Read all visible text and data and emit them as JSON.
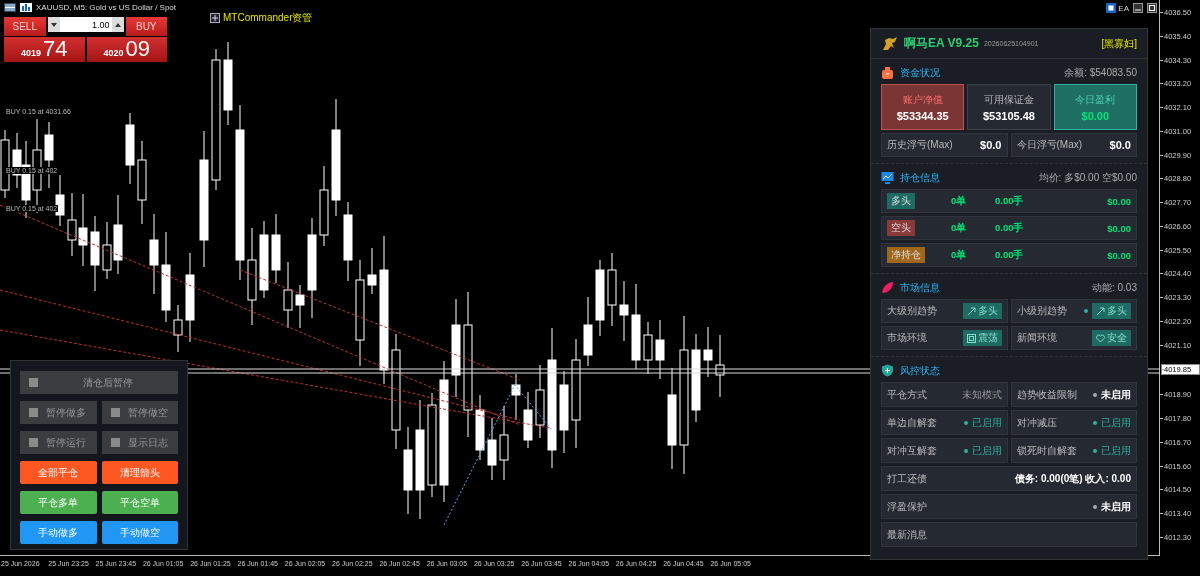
{
  "chart_header": {
    "symbol_title": "XAUUSD, M5:  Gold vs US Dollar / Spot"
  },
  "one_click": {
    "sell_label": "SELL",
    "buy_label": "BUY",
    "volume": "1.00",
    "sell_price_main": "4019",
    "sell_price_pips": "74",
    "buy_price_main": "4020",
    "buy_price_pips": "09"
  },
  "commander_label": "MTCommander资管",
  "top_right_label": "EA",
  "order_lines": [
    {
      "text": "BUY 0.15 at 4031.66"
    },
    {
      "text": "BUY 0.15 at 402"
    },
    {
      "text": "BUY 0.15 at 402"
    }
  ],
  "price_axis": {
    "ticks": [
      {
        "text": "4036.50",
        "current": false
      },
      {
        "text": "4035.40",
        "current": false
      },
      {
        "text": "4034.30",
        "current": false
      },
      {
        "text": "4033.20",
        "current": false
      },
      {
        "text": "4032.10",
        "current": false
      },
      {
        "text": "4031.00",
        "current": false
      },
      {
        "text": "4029.90",
        "current": false
      },
      {
        "text": "4028.80",
        "current": false
      },
      {
        "text": "4027.70",
        "current": false
      },
      {
        "text": "4026.60",
        "current": false
      },
      {
        "text": "4025.50",
        "current": false
      },
      {
        "text": "4024.40",
        "current": false
      },
      {
        "text": "4023.30",
        "current": false
      },
      {
        "text": "4022.20",
        "current": false
      },
      {
        "text": "4021.10",
        "current": false
      },
      {
        "text": "4019.85",
        "current": true
      },
      {
        "text": "4018.90",
        "current": false
      },
      {
        "text": "4017.80",
        "current": false
      },
      {
        "text": "4016.70",
        "current": false
      },
      {
        "text": "4015.60",
        "current": false
      },
      {
        "text": "4014.50",
        "current": false
      },
      {
        "text": "4013.40",
        "current": false
      },
      {
        "text": "4012.30",
        "current": false
      }
    ]
  },
  "time_axis": {
    "ticks": [
      "25 Jun 2026",
      "25 Jun 23:25",
      "25 Jun 23:45",
      "26 Jun 01:05",
      "26 Jun 01:25",
      "26 Jun 01:45",
      "26 Jun 02:05",
      "26 Jun 02:25",
      "26 Jun 02:45",
      "26 Jun 03:05",
      "26 Jun 03:25",
      "26 Jun 03:45",
      "26 Jun 04:05",
      "26 Jun 04:25",
      "26 Jun 04:45",
      "26 Jun 05:05"
    ]
  },
  "control_panel": {
    "toggles": [
      {
        "label": "清仓后暂停",
        "checked": false,
        "kind": "wide"
      },
      {
        "label": "暂停做多",
        "checked": false,
        "kind": "half"
      },
      {
        "label": "暂停做空",
        "checked": false,
        "kind": "half"
      },
      {
        "label": "暂停运行",
        "checked": false,
        "kind": "half"
      },
      {
        "label": "显示日志",
        "checked": false,
        "kind": "half"
      }
    ],
    "buttons": [
      {
        "label": "全部平仓",
        "color": "#ff5722"
      },
      {
        "label": "清理箭头",
        "color": "#ff5722"
      },
      {
        "label": "平仓多单",
        "color": "#4caf50"
      },
      {
        "label": "平仓空单",
        "color": "#4caf50"
      },
      {
        "label": "手动做多",
        "color": "#2196f3"
      },
      {
        "label": "手动做空",
        "color": "#2196f3"
      }
    ]
  },
  "ea_panel": {
    "title": "啊马EA V9.25",
    "build": "20260625104901",
    "tag": "[黑寡妇]",
    "funds": {
      "title": "资金状况",
      "summary": "余额: $54083.50",
      "cards": [
        {
          "label": "账户净值",
          "value": "$53344.35",
          "kind": "loss"
        },
        {
          "label": "可用保证金",
          "value": "$53105.48",
          "kind": "neutral"
        },
        {
          "label": "今日盈利",
          "value": "$0.00",
          "kind": "profit"
        }
      ],
      "stats": [
        {
          "label": "历史浮亏(Max)",
          "value": "$0.0"
        },
        {
          "label": "今日浮亏(Max)",
          "value": "$0.0"
        }
      ]
    },
    "positions": {
      "title": "持仓信息",
      "summary": "均价: 多$0.00  空$0.00",
      "rows": [
        {
          "tag": "多头",
          "color": "#1f6b63",
          "orders": "0单",
          "lots": "0.00手",
          "profit": "$0.00"
        },
        {
          "tag": "空头",
          "color": "#8b3a3a",
          "orders": "0单",
          "lots": "0.00手",
          "profit": "$0.00"
        },
        {
          "tag": "净持仓",
          "color": "#a0661c",
          "orders": "0单",
          "lots": "0.00手",
          "profit": "$0.00"
        }
      ]
    },
    "market": {
      "title": "市场信息",
      "summary": "动能: 0.03",
      "items": [
        {
          "label": "大级别趋势",
          "badge": "多头",
          "dot": false
        },
        {
          "label": "小级别趋势",
          "badge": "多头",
          "dot": true
        },
        {
          "label": "市场环境",
          "badge": "震荡",
          "dot": false
        },
        {
          "label": "新闻环境",
          "badge": "安全",
          "dot": false
        }
      ]
    },
    "risk": {
      "title": "风控状态",
      "grid": [
        {
          "label": "平仓方式",
          "value": "未知模式",
          "kind": "text"
        },
        {
          "label": "趋势收益限制",
          "value": "未启用",
          "kind": "status",
          "enabled": false
        },
        {
          "label": "单边自解套",
          "value": "已启用",
          "kind": "status",
          "enabled": true
        },
        {
          "label": "对冲减压",
          "value": "已启用",
          "kind": "status",
          "enabled": true
        },
        {
          "label": "对冲互解套",
          "value": "已启用",
          "kind": "status",
          "enabled": true
        },
        {
          "label": "锁死时自解套",
          "value": "已启用",
          "kind": "status",
          "enabled": true
        }
      ],
      "rows": [
        {
          "label": "打工还债",
          "value": "债务: 0.00(0笔) 收入: 0.00",
          "kind": "summary"
        },
        {
          "label": "浮盈保护",
          "value": "未启用",
          "kind": "status",
          "enabled": false
        },
        {
          "label": "最新消息",
          "kind": "empty"
        }
      ]
    }
  }
}
